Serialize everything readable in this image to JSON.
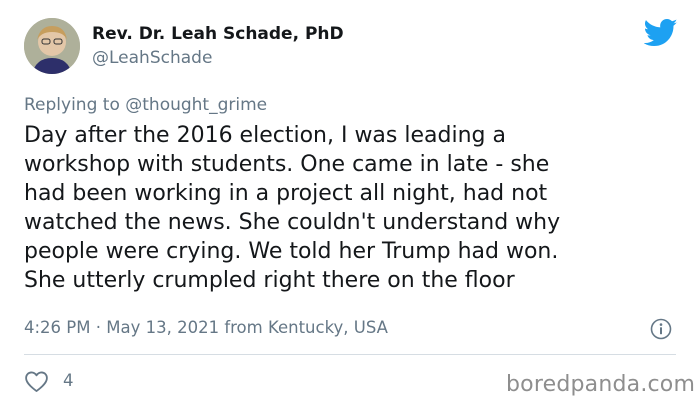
{
  "author": {
    "display_name": "Rev. Dr. Leah Schade, PhD",
    "handle": "@LeahSchade"
  },
  "reply": {
    "prefix": "Replying to",
    "handle": "@thought_grime"
  },
  "tweet": {
    "lines": [
      "Day after the 2016 election, I was leading a",
      "workshop with students. One came in late - she",
      "had been working in a project all night, had not",
      "watched the news. She couldn't understand why",
      "people were crying. We told her Trump had won.",
      "She utterly crumpled right there on the floor"
    ]
  },
  "meta": {
    "time": "4:26 PM",
    "separator": "·",
    "date": "May 13, 2021",
    "location": "from Kentucky, USA"
  },
  "actions": {
    "like_count": "4"
  },
  "watermark": "boredpanda.com",
  "colors": {
    "text": "#14171a",
    "muted": "#657786",
    "twitter_blue": "#1da1f2",
    "divider": "#d6dde3"
  },
  "icons": [
    "twitter-bird-icon",
    "info-icon",
    "heart-icon"
  ]
}
